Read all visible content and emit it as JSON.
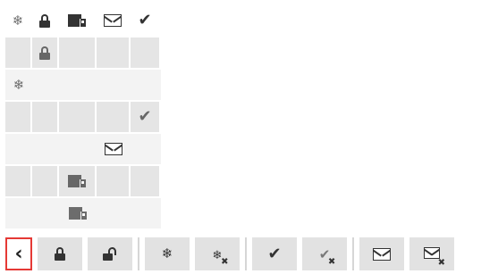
{
  "columns": [
    {
      "icon": "snowflake-icon"
    },
    {
      "icon": "lock-icon"
    },
    {
      "icon": "box-icon"
    },
    {
      "icon": "envelope-icon"
    },
    {
      "icon": "checkmark-icon"
    }
  ],
  "rows": [
    {
      "shade": "dark",
      "flags": [
        "",
        "lock-icon",
        "",
        "",
        ""
      ]
    },
    {
      "shade": "light",
      "flags": [
        "snowflake-icon",
        "",
        "",
        "",
        ""
      ]
    },
    {
      "shade": "dark",
      "flags": [
        "",
        "",
        "",
        "",
        "checkmark-icon"
      ]
    },
    {
      "shade": "light",
      "flags": [
        "",
        "",
        "",
        "envelope-icon",
        ""
      ]
    },
    {
      "shade": "dark",
      "flags": [
        "",
        "",
        "box-icon",
        "",
        ""
      ]
    },
    {
      "shade": "light",
      "flags": [
        "",
        "",
        "box-icon",
        "",
        ""
      ]
    }
  ],
  "toolbar": {
    "buttons": [
      {
        "name": "back-button",
        "icon": "chevron-left-icon",
        "glyph": "‹"
      },
      {
        "name": "lock-button",
        "icon": "lock-icon"
      },
      {
        "name": "unlock-button",
        "icon": "unlock-icon"
      },
      {
        "name": "freeze-button",
        "icon": "snowflake-icon"
      },
      {
        "name": "unfreeze-button",
        "icon": "snowflake-x-icon"
      },
      {
        "name": "approve-button",
        "icon": "checkmark-icon"
      },
      {
        "name": "unapprove-button",
        "icon": "checkmark-x-icon"
      },
      {
        "name": "mail-button",
        "icon": "envelope-icon"
      },
      {
        "name": "unmail-button",
        "icon": "envelope-x-icon"
      }
    ]
  },
  "colors": {
    "row_dark": "#e5e5e5",
    "row_light": "#f3f3f3",
    "button_bg": "#e2e2e2",
    "focus_border": "#e53935",
    "icon": "#333333"
  }
}
